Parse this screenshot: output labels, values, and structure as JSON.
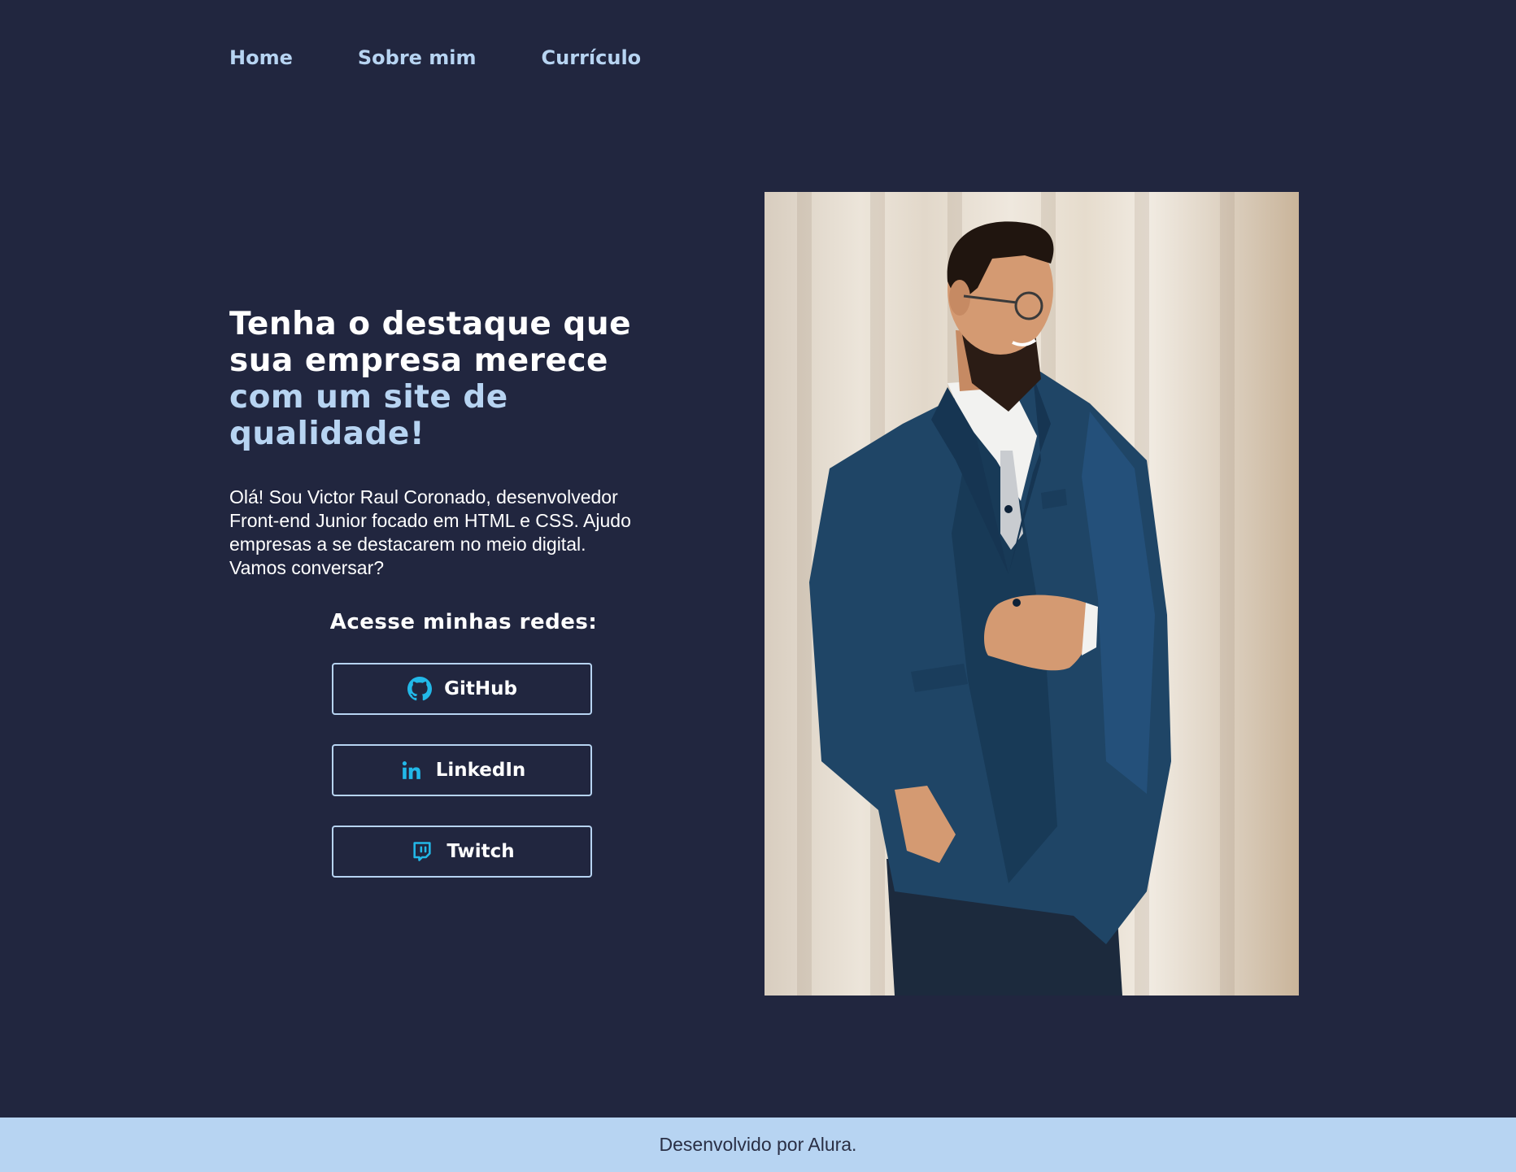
{
  "nav": {
    "home": "Home",
    "about": "Sobre mim",
    "resume": "Currículo"
  },
  "hero": {
    "headline_line1": "Tenha o destaque que",
    "headline_line2": "sua empresa merece",
    "headline_line3": "com um site de",
    "headline_line4": "qualidade!",
    "intro_line1": "Olá! Sou Victor Raul Coronado, desenvolvedor",
    "intro_line2": "Front-end Junior focado em HTML e CSS. Ajudo",
    "intro_line3": "empresas a se destacarem no meio digital.",
    "intro_line4": "Vamos conversar?"
  },
  "social": {
    "title": "Acesse minhas redes:",
    "buttons": [
      {
        "label": "GitHub",
        "icon": "github-icon"
      },
      {
        "label": "LinkedIn",
        "icon": "linkedin-icon"
      },
      {
        "label": "Twitch",
        "icon": "twitch-icon"
      }
    ]
  },
  "photo": {
    "subject": "portrait-photo"
  },
  "footer": {
    "text": "Desenvolvido por Alura."
  },
  "colors": {
    "background": "#21263f",
    "accent": "#b7d4f2",
    "icon": "#22b8e8"
  }
}
